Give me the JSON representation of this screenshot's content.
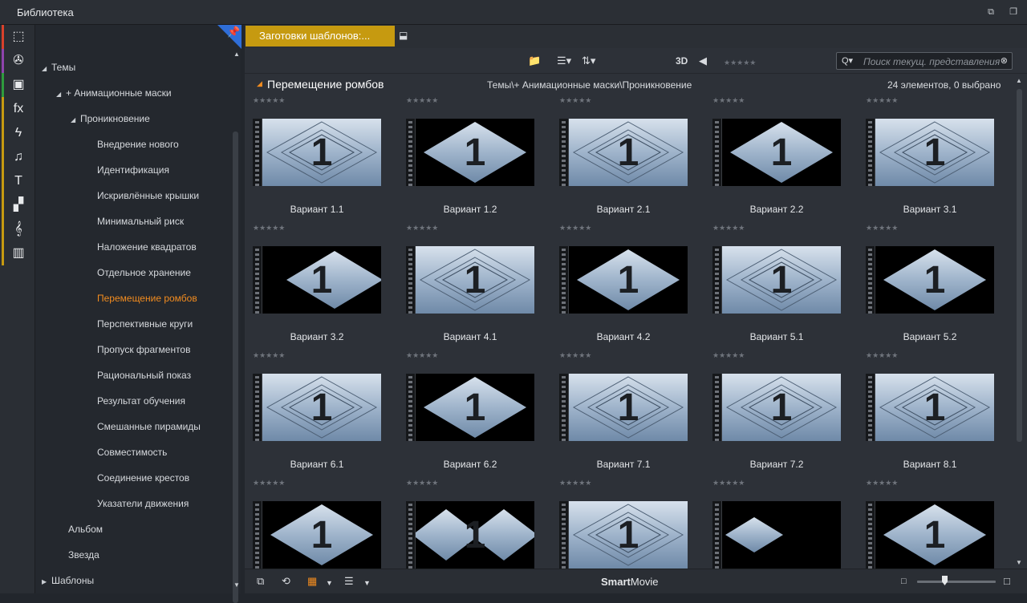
{
  "window": {
    "title": "Библиотека"
  },
  "iconbar": {
    "items": [
      {
        "name": "collections-icon",
        "glyph": "⬚",
        "stripe": "#d9412b"
      },
      {
        "name": "film-reel-icon",
        "glyph": "✇",
        "stripe": "#8e44ad"
      },
      {
        "name": "photos-icon",
        "glyph": "▣",
        "stripe": "#2e9b3d"
      },
      {
        "name": "fx-icon",
        "glyph": "fx",
        "stripe": "#c69a10"
      },
      {
        "name": "transitions-icon",
        "glyph": "ϟ",
        "stripe": "#c69a10"
      },
      {
        "name": "music-icon",
        "glyph": "♫",
        "stripe": "#c69a10"
      },
      {
        "name": "titles-icon",
        "glyph": "T",
        "stripe": "#c69a10"
      },
      {
        "name": "templates-icon",
        "glyph": "▞",
        "stripe": "#c69a10"
      },
      {
        "name": "scorefitter-icon",
        "glyph": "𝄞",
        "stripe": "#c69a10"
      },
      {
        "name": "piano-icon",
        "glyph": "▥",
        "stripe": "#c69a10"
      }
    ]
  },
  "tree": {
    "root": "Темы",
    "group": "+ Анимационные маски",
    "sub": "Проникновение",
    "items": [
      "Внедрение нового",
      "Идентификация",
      "Искривлённые крышки",
      "Минимальный риск",
      "Наложение квадратов",
      "Отдельное хранение",
      "Перемещение ромбов",
      "Перспективные круги",
      "Пропуск фрагментов",
      "Рациональный показ",
      "Результат обучения",
      "Смешанные пирамиды",
      "Совместимость",
      "Соединение крестов",
      "Указатели движения"
    ],
    "active": "Перемещение ромбов",
    "extra": [
      "Альбом",
      "Звезда"
    ],
    "bottom": "Шаблоны"
  },
  "tab": {
    "label": "Заготовки шаблонов:..."
  },
  "toolbar": {
    "three_d": "3D",
    "search_placeholder": "Поиск текущ. представления"
  },
  "header": {
    "name": "Перемещение ромбов",
    "path": "Темы\\+ Анимационные маски\\Проникновение",
    "count": "24 элементов, 0 выбрано"
  },
  "stars_text": "★★★★★",
  "tiles": [
    {
      "label": "Вариант 1.1",
      "bg": "full"
    },
    {
      "label": "Вариант 1.2",
      "bg": "small"
    },
    {
      "label": "Вариант 2.1",
      "bg": "full"
    },
    {
      "label": "Вариант 2.2",
      "bg": "small"
    },
    {
      "label": "Вариант 3.1",
      "bg": "full"
    },
    {
      "label": "Вариант 3.2",
      "bg": "right"
    },
    {
      "label": "Вариант 4.1",
      "bg": "full"
    },
    {
      "label": "Вариант 4.2",
      "bg": "small"
    },
    {
      "label": "Вариант 5.1",
      "bg": "full"
    },
    {
      "label": "Вариант 5.2",
      "bg": "small"
    },
    {
      "label": "Вариант 6.1",
      "bg": "full"
    },
    {
      "label": "Вариант 6.2",
      "bg": "small"
    },
    {
      "label": "Вариант 7.1",
      "bg": "full"
    },
    {
      "label": "Вариант 7.2",
      "bg": "full"
    },
    {
      "label": "Вариант 8.1",
      "bg": "full"
    },
    {
      "label": "",
      "bg": "small"
    },
    {
      "label": "",
      "bg": "split"
    },
    {
      "label": "",
      "bg": "full"
    },
    {
      "label": "",
      "bg": "left"
    },
    {
      "label": "",
      "bg": "small"
    }
  ],
  "bottombar": {
    "smart_bold": "Smart",
    "smart_rest": "Movie"
  }
}
